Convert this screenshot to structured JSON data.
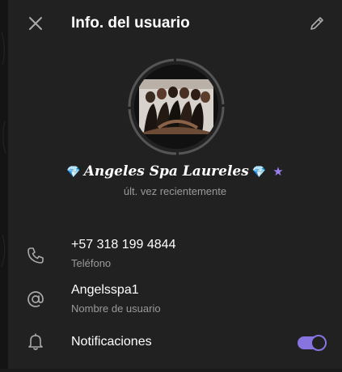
{
  "header": {
    "title": "Info. del usuario",
    "close_icon": "close-icon",
    "edit_icon": "pencil-icon"
  },
  "profile": {
    "gem_left": "💎",
    "name": "Angeles Spa Laureles",
    "gem_right": "💎",
    "badge": "★",
    "status": "últ. vez recientemente"
  },
  "details": {
    "phone": {
      "value": "+57 318 199 4844",
      "label": "Teléfono",
      "icon": "phone-icon"
    },
    "username": {
      "value": "Angelsspa1",
      "label": "Nombre de usuario",
      "icon": "at-icon"
    },
    "notifications": {
      "label": "Notificaciones",
      "icon": "bell-icon",
      "enabled": true
    }
  },
  "colors": {
    "background": "#212121",
    "accent": "#8774e1",
    "secondary_text": "#9a9a9a",
    "gem": "#5fc8ff"
  }
}
